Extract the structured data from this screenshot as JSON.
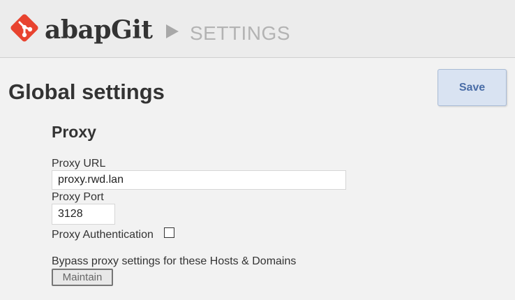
{
  "header": {
    "app_name": "abapGit",
    "breadcrumb_separator": "►",
    "page_name": "SETTINGS",
    "logo_icon": "git-diamond-logo-icon",
    "logo_color": "#e8432f"
  },
  "page": {
    "title": "Global settings",
    "save_label": "Save"
  },
  "proxy": {
    "section_title": "Proxy",
    "url_label": "Proxy URL",
    "url_value": "proxy.rwd.lan",
    "port_label": "Proxy Port",
    "port_value": "3128",
    "auth_label": "Proxy Authentication",
    "auth_checked": false,
    "bypass_label": "Bypass proxy settings for these Hosts & Domains",
    "maintain_label": "Maintain"
  },
  "colors": {
    "accent": "#4a6da7",
    "save_bg": "#d9e3f2",
    "background": "#f2f2f2"
  }
}
